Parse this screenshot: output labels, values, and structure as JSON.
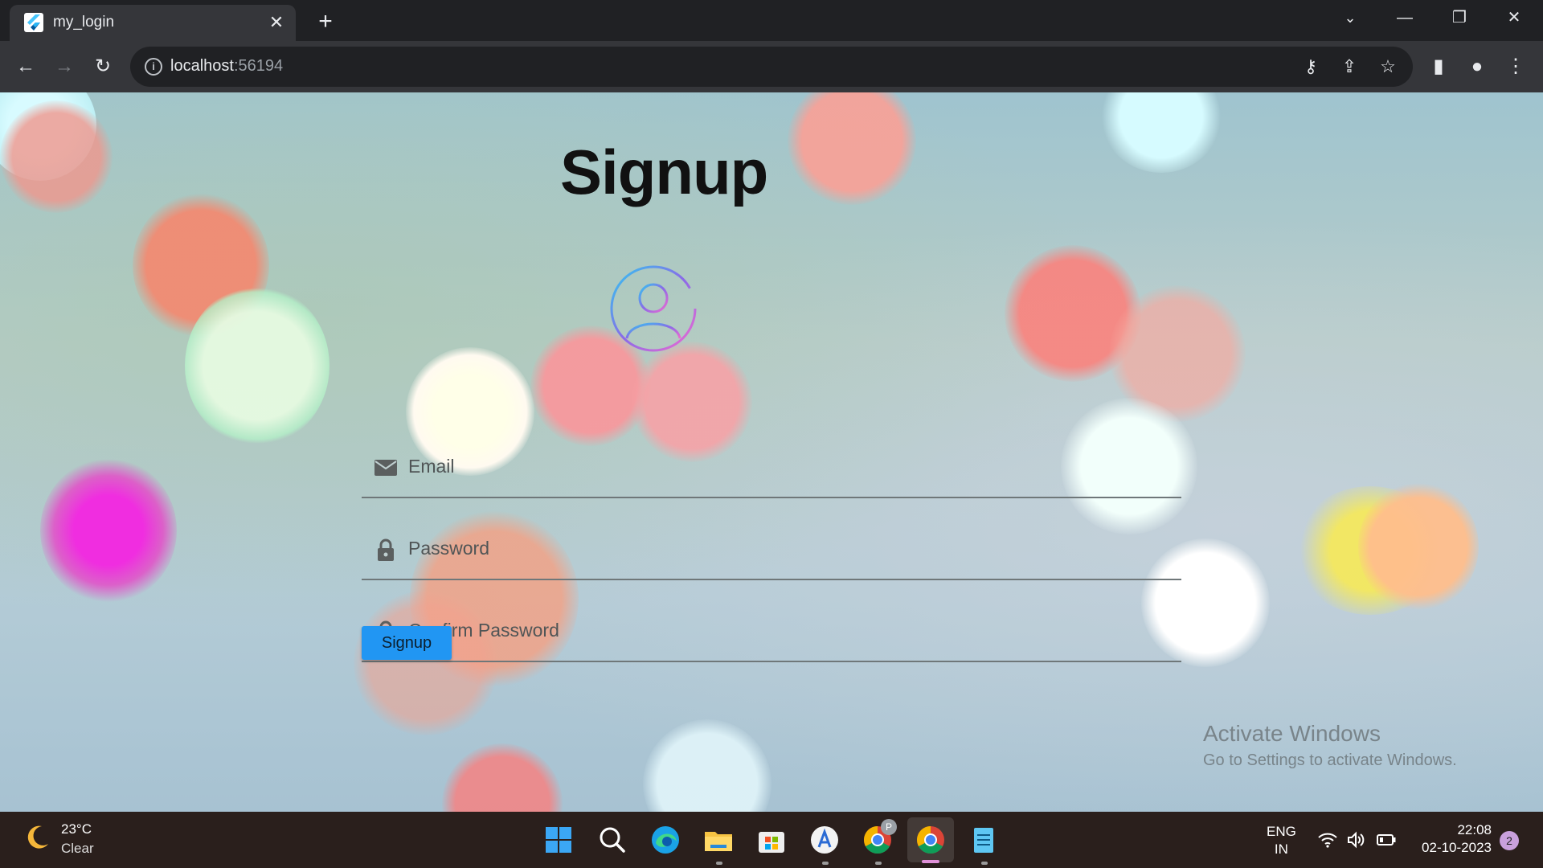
{
  "browser": {
    "tab_title": "my_login",
    "url_host": "localhost",
    "url_port": ":56194"
  },
  "page": {
    "title": "Signup",
    "email_placeholder": "Email",
    "password_placeholder": "Password",
    "confirm_placeholder": "Confirm Password",
    "button_label": "Signup",
    "accent_color": "#2196f3"
  },
  "watermark": {
    "title": "Activate Windows",
    "subtitle": "Go to Settings to activate Windows."
  },
  "taskbar": {
    "temperature": "23°C",
    "condition": "Clear",
    "lang_line1": "ENG",
    "lang_line2": "IN",
    "time": "22:08",
    "date": "02-10-2023",
    "notification_count": "2",
    "chrome_profile_badge": "P"
  }
}
